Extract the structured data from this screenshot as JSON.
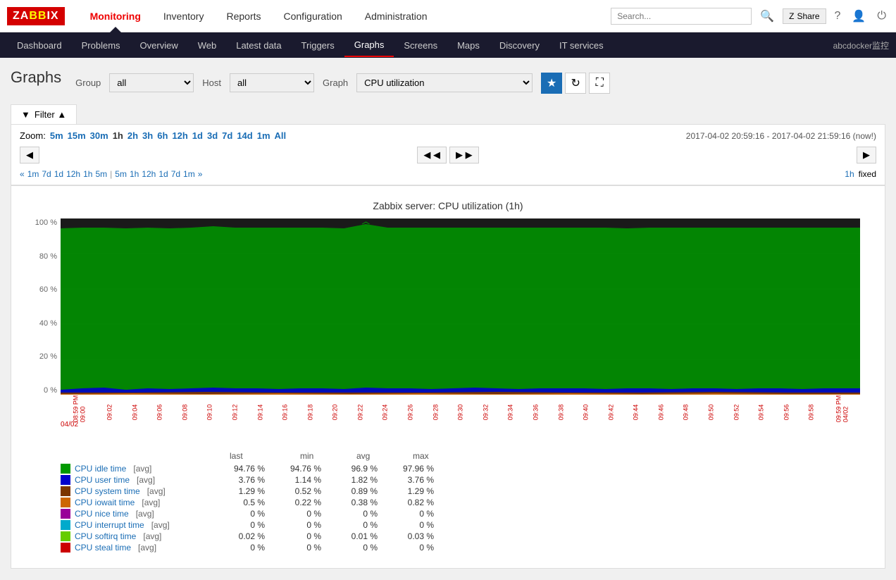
{
  "logo": {
    "text": "ZABBIX"
  },
  "topnav": {
    "links": [
      {
        "id": "monitoring",
        "label": "Monitoring",
        "active": true
      },
      {
        "id": "inventory",
        "label": "Inventory",
        "active": false
      },
      {
        "id": "reports",
        "label": "Reports",
        "active": false
      },
      {
        "id": "configuration",
        "label": "Configuration",
        "active": false
      },
      {
        "id": "administration",
        "label": "Administration",
        "active": false
      }
    ],
    "search_placeholder": "Search...",
    "share_label": "Share",
    "user_label": "abcdocker监控"
  },
  "subnav": {
    "links": [
      {
        "id": "dashboard",
        "label": "Dashboard"
      },
      {
        "id": "problems",
        "label": "Problems"
      },
      {
        "id": "overview",
        "label": "Overview"
      },
      {
        "id": "web",
        "label": "Web"
      },
      {
        "id": "latest-data",
        "label": "Latest data"
      },
      {
        "id": "triggers",
        "label": "Triggers"
      },
      {
        "id": "graphs",
        "label": "Graphs",
        "active": true
      },
      {
        "id": "screens",
        "label": "Screens"
      },
      {
        "id": "maps",
        "label": "Maps"
      },
      {
        "id": "discovery",
        "label": "Discovery"
      },
      {
        "id": "it-services",
        "label": "IT services"
      }
    ]
  },
  "page": {
    "title": "Graphs"
  },
  "filter": {
    "group_label": "Group",
    "group_value": "all",
    "host_label": "Host",
    "host_value": "all",
    "graph_label": "Graph",
    "graph_value": "CPU utilization",
    "toggle_label": "Filter ▲"
  },
  "zoom": {
    "label": "Zoom:",
    "options": [
      "5m",
      "15m",
      "30m",
      "1h",
      "2h",
      "3h",
      "6h",
      "12h",
      "1d",
      "3d",
      "7d",
      "14d",
      "1m",
      "All"
    ]
  },
  "time_range": "2017-04-02 20:59:16 - 2017-04-02 21:59:16 (now!)",
  "time_steps_left": [
    "«",
    "1m",
    "7d",
    "1d",
    "12h",
    "1h",
    "5m",
    "|",
    "5m",
    "1h",
    "12h",
    "1d",
    "7d",
    "1m",
    "»"
  ],
  "time_steps_right": [
    "1h",
    "fixed"
  ],
  "chart": {
    "title": "Zabbix server: CPU utilization (1h)",
    "y_labels": [
      "100 %",
      "80 %",
      "60 %",
      "40 %",
      "20 %",
      "0 %"
    ],
    "x_labels": [
      "09:00",
      "09:02",
      "09:04",
      "09:06",
      "09:08",
      "09:10",
      "09:12",
      "09:14",
      "09:16",
      "09:18",
      "09:20",
      "09:22",
      "09:24",
      "09:26",
      "09:28",
      "09:30",
      "09:32",
      "09:34",
      "09:36",
      "09:38",
      "09:40",
      "09:42",
      "09:44",
      "09:46",
      "09:48",
      "09:50",
      "09:52",
      "09:54",
      "09:56",
      "09:58"
    ],
    "date_label_left": "04/02",
    "date_label_right": "04/02",
    "time_label_left": "08:59 PM",
    "time_label_right": "09:59 PM"
  },
  "legend": {
    "headers": [
      "",
      "last",
      "min",
      "avg",
      "max"
    ],
    "rows": [
      {
        "color": "#009900",
        "name": "CPU idle time",
        "tag": "[avg]",
        "last": "94.76 %",
        "min": "94.76 %",
        "avg": "96.9 %",
        "max": "97.96 %"
      },
      {
        "color": "#0000cc",
        "name": "CPU user time",
        "tag": "[avg]",
        "last": "3.76 %",
        "min": "1.14 %",
        "avg": "1.82 %",
        "max": "3.76 %"
      },
      {
        "color": "#7b3500",
        "name": "CPU system time",
        "tag": "[avg]",
        "last": "1.29 %",
        "min": "0.52 %",
        "avg": "0.89 %",
        "max": "1.29 %"
      },
      {
        "color": "#cc6600",
        "name": "CPU iowait time",
        "tag": "[avg]",
        "last": "0.5 %",
        "min": "0.22 %",
        "avg": "0.38 %",
        "max": "0.82 %"
      },
      {
        "color": "#990099",
        "name": "CPU nice time",
        "tag": "[avg]",
        "last": "0 %",
        "min": "0 %",
        "avg": "0 %",
        "max": "0 %"
      },
      {
        "color": "#00aacc",
        "name": "CPU interrupt time",
        "tag": "[avg]",
        "last": "0 %",
        "min": "0 %",
        "avg": "0 %",
        "max": "0 %"
      },
      {
        "color": "#66cc00",
        "name": "CPU softirq time",
        "tag": "[avg]",
        "last": "0.02 %",
        "min": "0 %",
        "avg": "0.01 %",
        "max": "0.03 %"
      },
      {
        "color": "#cc0000",
        "name": "CPU steal time",
        "tag": "[avg]",
        "last": "0 %",
        "min": "0 %",
        "avg": "0 %",
        "max": "0 %"
      }
    ]
  }
}
